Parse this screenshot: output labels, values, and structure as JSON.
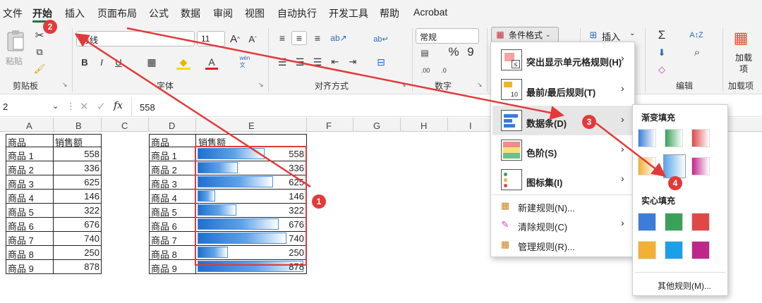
{
  "tabs": [
    "文件",
    "开始",
    "插入",
    "页面布局",
    "公式",
    "数据",
    "审阅",
    "视图",
    "自动执行",
    "开发工具",
    "帮助",
    "Acrobat"
  ],
  "ribbon": {
    "paste": "粘贴",
    "clipboard": "剪贴板",
    "font_group": "字体",
    "align_group": "对齐方式",
    "number_group": "数字",
    "edit_group": "编辑",
    "addin_group": "加载项",
    "font_name": "等线",
    "font_size": "11",
    "number_format": "常规",
    "cond_format": "条件格式",
    "insert": "插入",
    "addin_label": "加载项"
  },
  "formula": {
    "namebox": "2",
    "fx": "fx",
    "value": "558"
  },
  "columns": [
    "A",
    "B",
    "C",
    "D",
    "E",
    "F",
    "G",
    "H",
    "I"
  ],
  "table_left": {
    "header": [
      "商品",
      "销售额"
    ],
    "rows": [
      [
        "商品 1",
        "558"
      ],
      [
        "商品 2",
        "336"
      ],
      [
        "商品 3",
        "625"
      ],
      [
        "商品 4",
        "146"
      ],
      [
        "商品 5",
        "322"
      ],
      [
        "商品 6",
        "676"
      ],
      [
        "商品 7",
        "740"
      ],
      [
        "商品 8",
        "250"
      ],
      [
        "商品 9",
        "878"
      ]
    ]
  },
  "table_right": {
    "header": [
      "商品",
      "销售额"
    ],
    "rows": [
      [
        "商品 1",
        "558"
      ],
      [
        "商品 2",
        "336"
      ],
      [
        "商品 3",
        "625"
      ],
      [
        "商品 4",
        "146"
      ],
      [
        "商品 5",
        "322"
      ],
      [
        "商品 6",
        "676"
      ],
      [
        "商品 7",
        "740"
      ],
      [
        "商品 8",
        "250"
      ],
      [
        "商品 9",
        "878"
      ]
    ],
    "bar_values": [
      558,
      336,
      625,
      146,
      322,
      676,
      740,
      250,
      878
    ],
    "bar_max": 878
  },
  "dropdown": {
    "items": [
      "突出显示单元格规则(H)",
      "最前/最后规则(T)",
      "数据条(D)",
      "色阶(S)",
      "图标集(I)",
      "新建规则(N)...",
      "清除规则(C)",
      "管理规则(R)..."
    ]
  },
  "submenu": {
    "gradient": "渐变填充",
    "solid": "实心填充",
    "more": "其他规则(M)..."
  },
  "badges": [
    "1",
    "2",
    "3",
    "4"
  ],
  "colors": {
    "accent": "#217346",
    "blue": "#1f6fd1",
    "green": "#3aa15a",
    "red": "#e04848",
    "orange": "#f2b035",
    "magenta": "#c0258a",
    "annotation": "#e23a3a"
  }
}
